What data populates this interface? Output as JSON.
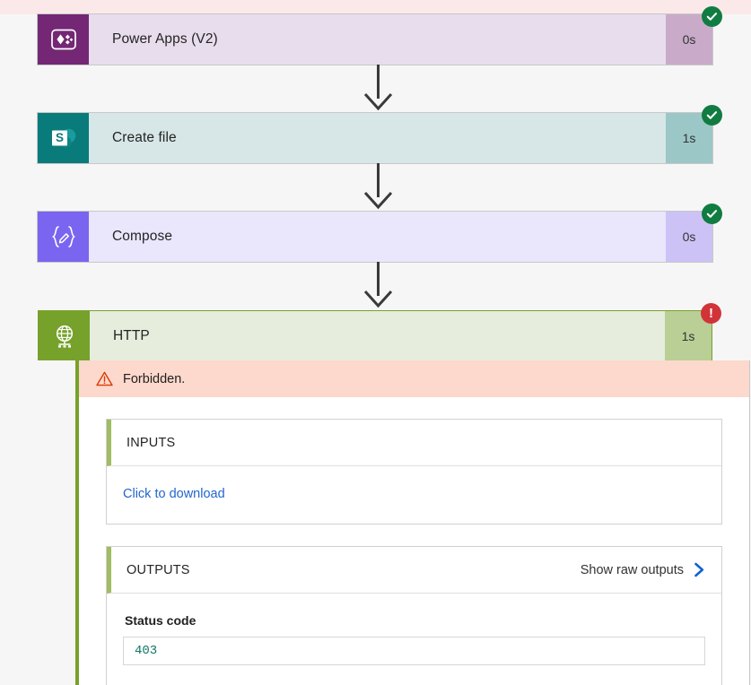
{
  "colors": {
    "page_background": "#f7f6f7",
    "top_strip": "#fbe9e9",
    "success": "#107c41",
    "error": "#d13438",
    "http_accent": "#76a22c",
    "error_banner": "#fdd8cc",
    "link_blue": "#2266cc",
    "status_value": "#117865"
  },
  "flow": {
    "steps": [
      {
        "title": "Power Apps (V2)",
        "duration": "0s",
        "status": "succeeded",
        "icon": "power-apps-icon",
        "card_color": "#e8dded",
        "icon_color": "#742774"
      },
      {
        "title": "Create file",
        "duration": "1s",
        "status": "succeeded",
        "icon": "sharepoint-icon",
        "card_color": "#d7e6e6",
        "icon_color": "#0a7b7b"
      },
      {
        "title": "Compose",
        "duration": "0s",
        "status": "succeeded",
        "icon": "compose-icon",
        "card_color": "#eae6fb",
        "icon_color": "#7a65f0"
      },
      {
        "title": "HTTP",
        "duration": "1s",
        "status": "failed",
        "icon": "http-globe-icon",
        "card_color": "#e6eddd",
        "icon_color": "#76a22c"
      }
    ]
  },
  "http_detail": {
    "error_message": "Forbidden.",
    "inputs": {
      "heading": "INPUTS",
      "download_label": "Click to download"
    },
    "outputs": {
      "heading": "OUTPUTS",
      "raw_link_label": "Show raw outputs",
      "status_code_label": "Status code",
      "status_code_value": "403"
    }
  }
}
